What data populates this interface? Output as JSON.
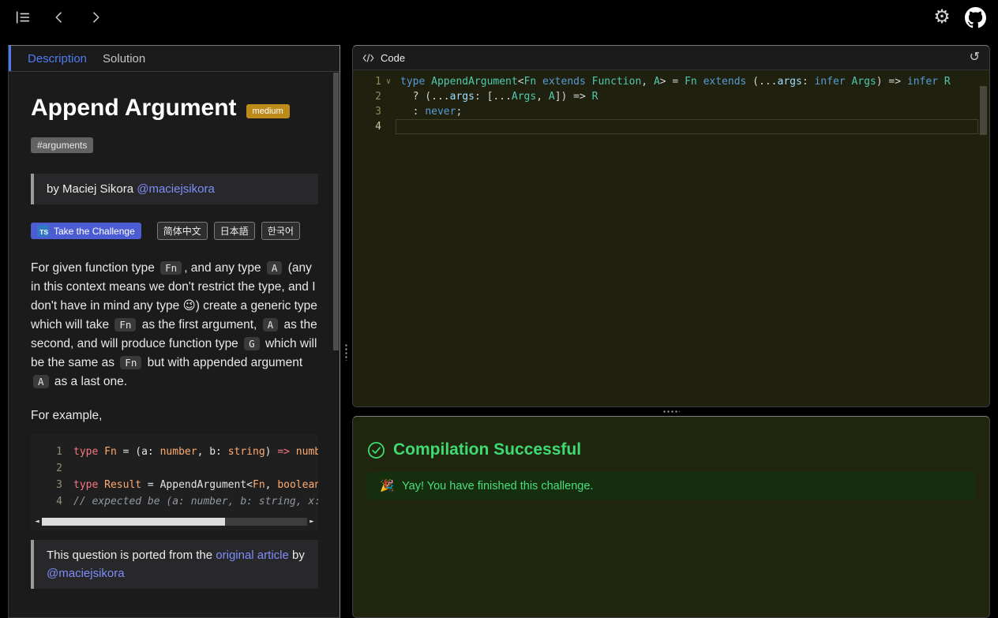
{
  "colors": {
    "accent": "#4f7cf0",
    "link": "#7d8ef9",
    "primary-button": "#4c5dd4",
    "success": "#3fdb72",
    "difficulty": "#bd8b1a"
  },
  "icons": {
    "gear": "⚙",
    "reset": "↺",
    "scroll_left": "◄",
    "scroll_right": "►"
  },
  "tabs": {
    "description": "Description",
    "solution": "Solution"
  },
  "challenge": {
    "title": "Append Argument",
    "difficulty": "medium",
    "tag": "#arguments",
    "author": [
      {
        "t": "text",
        "v": "by Maciej Sikora "
      },
      {
        "t": "link",
        "v": "@maciejsikora"
      }
    ],
    "ts_logo": "TS",
    "take_challenge": "Take the Challenge",
    "languages": [
      "简体中文",
      "日本語",
      "한국어"
    ],
    "description": [
      {
        "t": "text",
        "v": "For given function type "
      },
      {
        "t": "code",
        "v": "Fn"
      },
      {
        "t": "text",
        "v": ", and any type "
      },
      {
        "t": "code",
        "v": "A"
      },
      {
        "t": "text",
        "v": " (any in this context means we don't restrict the type, and I don't have in mind any type "
      },
      {
        "t": "emoji",
        "v": "😉"
      },
      {
        "t": "text",
        "v": ") create a generic type which will take "
      },
      {
        "t": "code",
        "v": "Fn"
      },
      {
        "t": "text",
        "v": " as the first argument, "
      },
      {
        "t": "code",
        "v": "A"
      },
      {
        "t": "text",
        "v": " as the second, and will produce function type "
      },
      {
        "t": "code",
        "v": "G"
      },
      {
        "t": "text",
        "v": " which will be the same as "
      },
      {
        "t": "code",
        "v": "Fn"
      },
      {
        "t": "text",
        "v": " but with appended argument "
      },
      {
        "t": "code",
        "v": "A"
      },
      {
        "t": "text",
        "v": " as a last one."
      }
    ],
    "for_example": "For example,",
    "example_code": [
      {
        "num": "1",
        "tokens": [
          {
            "s": "k",
            "t": "type"
          },
          {
            "s": "p",
            "t": " "
          },
          {
            "s": "t",
            "t": "Fn"
          },
          {
            "s": "p",
            "t": " = ("
          },
          {
            "s": "p",
            "t": "a: "
          },
          {
            "s": "t",
            "t": "number"
          },
          {
            "s": "p",
            "t": ", b: "
          },
          {
            "s": "t",
            "t": "string"
          },
          {
            "s": "p",
            "t": ") "
          },
          {
            "s": "k",
            "t": "=>"
          },
          {
            "s": "t",
            "t": " number"
          }
        ]
      },
      {
        "num": "2",
        "tokens": []
      },
      {
        "num": "3",
        "tokens": [
          {
            "s": "k",
            "t": "type"
          },
          {
            "s": "p",
            "t": " "
          },
          {
            "s": "t",
            "t": "Result"
          },
          {
            "s": "p",
            "t": " = AppendArgument<"
          },
          {
            "s": "t",
            "t": "Fn"
          },
          {
            "s": "p",
            "t": ", "
          },
          {
            "s": "t",
            "t": "boolean"
          },
          {
            "s": "p",
            "t": ">"
          }
        ]
      },
      {
        "num": "4",
        "tokens": [
          {
            "s": "c",
            "t": "// expected be (a: number, b: string, x: boolean) => number"
          }
        ]
      }
    ],
    "ported": [
      {
        "t": "text",
        "v": "This question is ported from the "
      },
      {
        "t": "link",
        "v": "original article"
      },
      {
        "t": "text",
        "v": " by "
      },
      {
        "t": "link",
        "v": "@maciejsikora"
      }
    ]
  },
  "editor": {
    "title": "Code",
    "lines": [
      {
        "num": "1",
        "fold": true,
        "tokens": [
          {
            "s": "kw",
            "t": "type"
          },
          {
            "s": "pl",
            "t": " "
          },
          {
            "s": "ty",
            "t": "AppendArgument"
          },
          {
            "s": "pl",
            "t": "<"
          },
          {
            "s": "ty",
            "t": "Fn"
          },
          {
            "s": "pl",
            "t": " "
          },
          {
            "s": "kw",
            "t": "extends"
          },
          {
            "s": "pl",
            "t": " "
          },
          {
            "s": "ty",
            "t": "Function"
          },
          {
            "s": "pl",
            "t": ", "
          },
          {
            "s": "ty",
            "t": "A"
          },
          {
            "s": "pl",
            "t": "> = "
          },
          {
            "s": "ty",
            "t": "Fn"
          },
          {
            "s": "pl",
            "t": " "
          },
          {
            "s": "kw",
            "t": "extends"
          },
          {
            "s": "pl",
            "t": " (..."
          },
          {
            "s": "va",
            "t": "args"
          },
          {
            "s": "pl",
            "t": ": "
          },
          {
            "s": "kw",
            "t": "infer"
          },
          {
            "s": "pl",
            "t": " "
          },
          {
            "s": "ty",
            "t": "Args"
          },
          {
            "s": "pl",
            "t": ") => "
          },
          {
            "s": "kw",
            "t": "infer"
          },
          {
            "s": "pl",
            "t": " "
          },
          {
            "s": "ty",
            "t": "R"
          }
        ]
      },
      {
        "num": "2",
        "tokens": [
          {
            "s": "pl",
            "t": "  ? (..."
          },
          {
            "s": "va",
            "t": "args"
          },
          {
            "s": "pl",
            "t": ": [..."
          },
          {
            "s": "ty",
            "t": "Args"
          },
          {
            "s": "pl",
            "t": ", "
          },
          {
            "s": "ty",
            "t": "A"
          },
          {
            "s": "pl",
            "t": "]) => "
          },
          {
            "s": "ty",
            "t": "R"
          }
        ]
      },
      {
        "num": "3",
        "tokens": [
          {
            "s": "pl",
            "t": "  : "
          },
          {
            "s": "kw",
            "t": "never"
          },
          {
            "s": "pl",
            "t": ";"
          }
        ]
      },
      {
        "num": "4",
        "active": true,
        "tokens": []
      }
    ]
  },
  "result": {
    "title": "Compilation Successful",
    "emoji": "🎉",
    "message": "Yay! You have finished this challenge."
  }
}
